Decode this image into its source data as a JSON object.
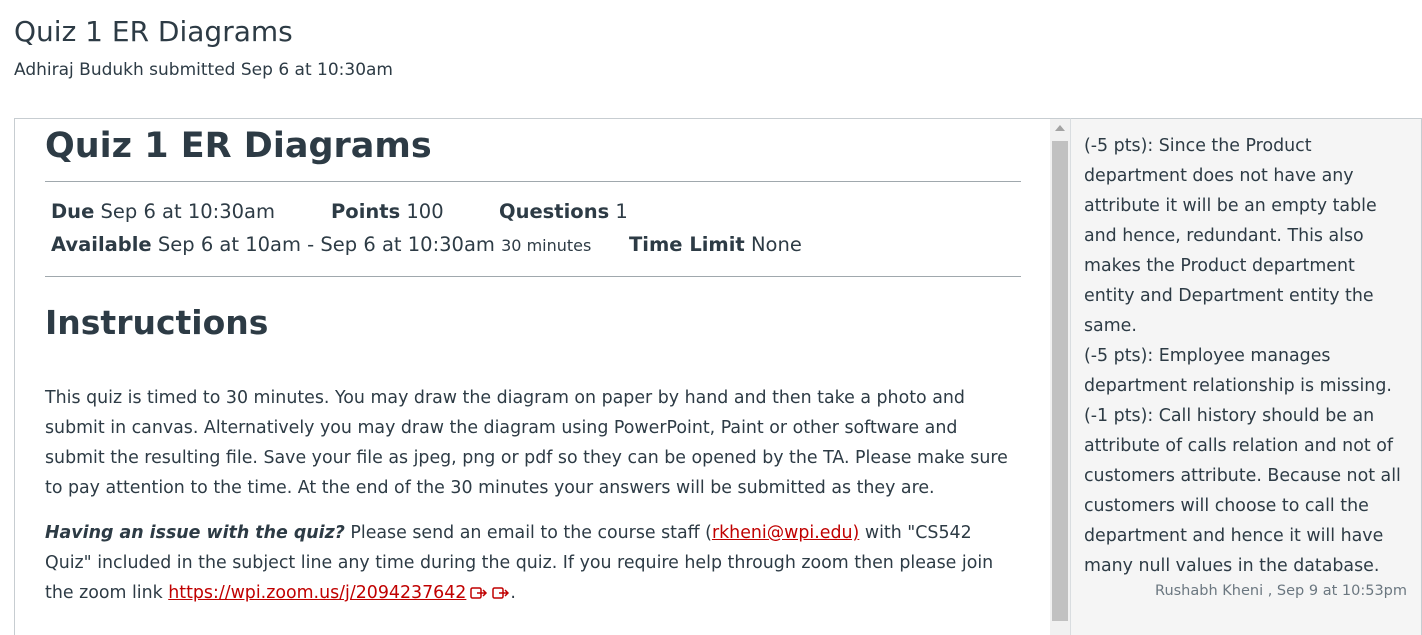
{
  "header": {
    "title": "Quiz 1 ER Diagrams",
    "submitted": "Adhiraj Budukh submitted Sep 6 at 10:30am"
  },
  "quiz": {
    "title": "Quiz 1 ER Diagrams",
    "due_label": "Due",
    "due_value": "Sep 6 at 10:30am",
    "points_label": "Points",
    "points_value": "100",
    "questions_label": "Questions",
    "questions_value": "1",
    "available_label": "Available",
    "available_value": "Sep 6 at 10am - Sep 6 at 10:30am",
    "available_duration": "30 minutes",
    "time_limit_label": "Time Limit",
    "time_limit_value": "None",
    "instructions_heading": "Instructions",
    "instructions_para1": "This quiz is timed to 30 minutes. You may draw the diagram on paper by hand and then take a photo and submit in canvas. Alternatively you may draw the diagram using PowerPoint, Paint or other software and submit the resulting file. Save your file as jpeg, png or pdf so they can be opened by the TA. Please make sure to pay attention to the time. At the end of the 30 minutes your answers will be submitted as they are.",
    "issue_lead": "Having an issue with the quiz?",
    "issue_text_1": " Please send an email to the course staff (",
    "email_link": "rkheni@wpi.edu)",
    "issue_text_2": " with \"CS542 Quiz\" included in the subject line any time during the quiz. If you require help through zoom then please join the zoom link ",
    "zoom_link": "https://wpi.zoom.us/j/2094237642",
    "issue_end": "."
  },
  "comment": {
    "text": "(-5 pts): Since the Product department does not have any attribute it will be an empty table and hence, redundant. This also makes the Product department entity and Department entity the same.\n(-5 pts): Employee manages department relationship is missing.\n(-1 pts): Call history should be an attribute of calls relation and not of customers attribute. Because not all customers will choose to call the department and hence it will have many null values in the database.",
    "author": "Rushabh Kheni , Sep 9 at 10:53pm"
  },
  "icons": {
    "external_link": "external-link-icon",
    "scroll_up": "scroll-up-arrow-icon"
  },
  "colors": {
    "text": "#2d3b45",
    "link": "#c00000",
    "comment_bg": "#f5f5f5",
    "muted": "#6b7780"
  }
}
